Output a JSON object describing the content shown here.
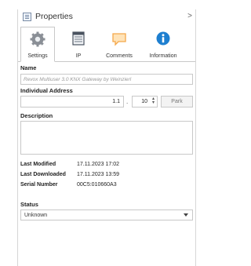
{
  "header": {
    "title": "Properties",
    "chevron": ">"
  },
  "tabs": [
    {
      "label": "Settings",
      "icon": "gear-icon",
      "active": true
    },
    {
      "label": "IP",
      "icon": "ip-table-icon",
      "active": false
    },
    {
      "label": "Comments",
      "icon": "comment-icon",
      "active": false
    },
    {
      "label": "Information",
      "icon": "info-icon",
      "active": false
    }
  ],
  "name": {
    "label": "Name",
    "value": "Revox Multiuser 3.0 KNX Gateway by Weinzierl"
  },
  "address": {
    "label": "Individual Address",
    "prefix": "1.1",
    "separator": ".",
    "device": "10",
    "park_label": "Park"
  },
  "description": {
    "label": "Description",
    "value": ""
  },
  "meta": {
    "last_modified_label": "Last Modified",
    "last_modified": "17.11.2023 17:02",
    "last_downloaded_label": "Last Downloaded",
    "last_downloaded": "17.11.2023 13:59",
    "serial_label": "Serial Number",
    "serial": "00C5:010660A3"
  },
  "status": {
    "label": "Status",
    "value": "Unknown"
  },
  "colors": {
    "accent_blue": "#1e7fd0",
    "comment_orange": "#f4a74a",
    "border": "#c8c8c8"
  }
}
